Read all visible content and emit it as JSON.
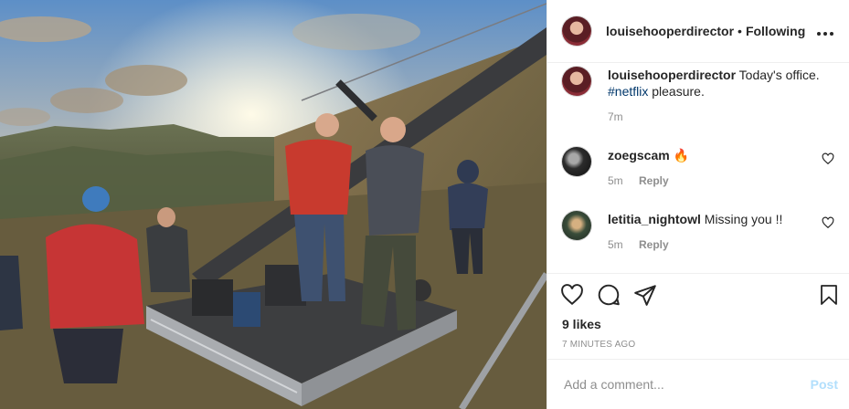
{
  "post": {
    "photo_icon": "film-set-photo"
  },
  "header": {
    "username": "louisehooperdirector",
    "separator": "•",
    "follow_state": "Following",
    "more_icon": "more-icon",
    "more_label": "•••"
  },
  "caption": {
    "username": "louisehooperdirector",
    "text": "Today's office.",
    "hashtag": "#netflix",
    "text_after": "pleasure.",
    "time": "7m"
  },
  "comments": [
    {
      "username": "zoegscam",
      "text": "🔥",
      "time": "5m",
      "reply_label": "Reply"
    },
    {
      "username": "letitia_nightowl",
      "text": "Missing you !!",
      "time": "5m",
      "reply_label": "Reply"
    }
  ],
  "actions": {
    "likes": "9 likes",
    "timestamp": "7 MINUTES AGO"
  },
  "add_comment": {
    "placeholder": "Add a comment...",
    "post_label": "Post"
  },
  "colors": {
    "link": "#00376b",
    "post_button": "#b2dffc",
    "muted": "#8e8e8e"
  }
}
